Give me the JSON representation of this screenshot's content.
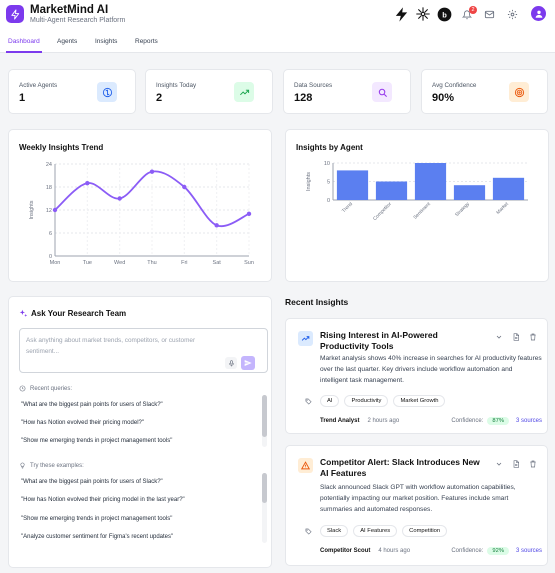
{
  "app": {
    "title": "MarketMind AI",
    "subtitle": "Multi-Agent Research Platform",
    "notification_count": "2"
  },
  "tabs": [
    {
      "label": "Dashboard",
      "active": true
    },
    {
      "label": "Agents",
      "active": false
    },
    {
      "label": "Insights",
      "active": false
    },
    {
      "label": "Reports",
      "active": false
    }
  ],
  "stats": [
    {
      "label": "Active Agents",
      "value": "1",
      "icon": "brain-icon",
      "color": "#dbeafe"
    },
    {
      "label": "Insights Today",
      "value": "2",
      "icon": "trending-up-icon",
      "color": "#dcfce7"
    },
    {
      "label": "Data Sources",
      "value": "128",
      "icon": "search-icon",
      "color": "#f3e8ff"
    },
    {
      "label": "Avg Confidence",
      "value": "90%",
      "icon": "target-icon",
      "color": "#ffedd5"
    }
  ],
  "weekly_chart": {
    "title": "Weekly Insights Trend",
    "chart_data": {
      "type": "line",
      "x": [
        "Mon",
        "Tue",
        "Wed",
        "Thu",
        "Fri",
        "Sat",
        "Sun"
      ],
      "series": [
        {
          "values": [
            12,
            19,
            15,
            22,
            18,
            8,
            11
          ]
        }
      ],
      "ylabel": "Insights",
      "yticks": [
        "0",
        "6",
        "12",
        "18",
        "24"
      ],
      "ylim": [
        0,
        24
      ],
      "color": "#8b5cf6",
      "grid": true
    }
  },
  "agent_chart": {
    "title": "Insights by Agent",
    "chart_data": {
      "type": "bar",
      "categories": [
        "Trend",
        "Competitor",
        "Sentiment",
        "Strategy",
        "Market"
      ],
      "values": [
        8,
        5,
        10,
        4,
        6
      ],
      "ylabel": "Insights",
      "yticks": [
        "0",
        "5",
        "10"
      ],
      "ylim": [
        0,
        10
      ],
      "color": "#5b7ff0",
      "grid": true
    }
  },
  "ask": {
    "title": "Ask Your Research Team",
    "placeholder": "Ask anything about market trends, competitors, or customer sentiment...",
    "recent_label": "Recent queries:",
    "recent": [
      "\"What are the biggest pain points for users of Slack?\"",
      "\"How has Notion evolved their pricing model?\"",
      "\"Show me emerging trends in project management tools\""
    ],
    "examples_label": "Try these examples:",
    "examples": [
      "\"What are the biggest pain points for users of Slack?\"",
      "\"How has Notion evolved their pricing model in the last year?\"",
      "\"Show me emerging trends in project management tools\"",
      "\"Analyze customer sentiment for Figma's recent updates\""
    ]
  },
  "recent_insights": {
    "title": "Recent Insights",
    "items": [
      {
        "icon": "trending-up-icon",
        "icon_color": "#dbeafe",
        "title": "Rising Interest in AI-Powered Productivity Tools",
        "body": "Market analysis shows 40% increase in searches for AI productivity features over the last quarter. Key drivers include workflow automation and intelligent task management.",
        "tags": [
          "AI",
          "Productivity",
          "Market Growth"
        ],
        "agent": "Trend Analyst",
        "time": "2 hours ago",
        "confidence_label": "Confidence:",
        "confidence": "87%",
        "sources": "3 sources"
      },
      {
        "icon": "alert-triangle-icon",
        "icon_color": "#ffedd5",
        "title": "Competitor Alert: Slack Introduces New AI Features",
        "body": "Slack announced Slack GPT with workflow automation capabilities, potentially impacting our market position. Features include smart summaries and automated responses.",
        "tags": [
          "Slack",
          "AI Features",
          "Competition"
        ],
        "agent": "Competitor Scout",
        "time": "4 hours ago",
        "confidence_label": "Confidence:",
        "confidence": "92%",
        "sources": "3 sources"
      }
    ]
  }
}
